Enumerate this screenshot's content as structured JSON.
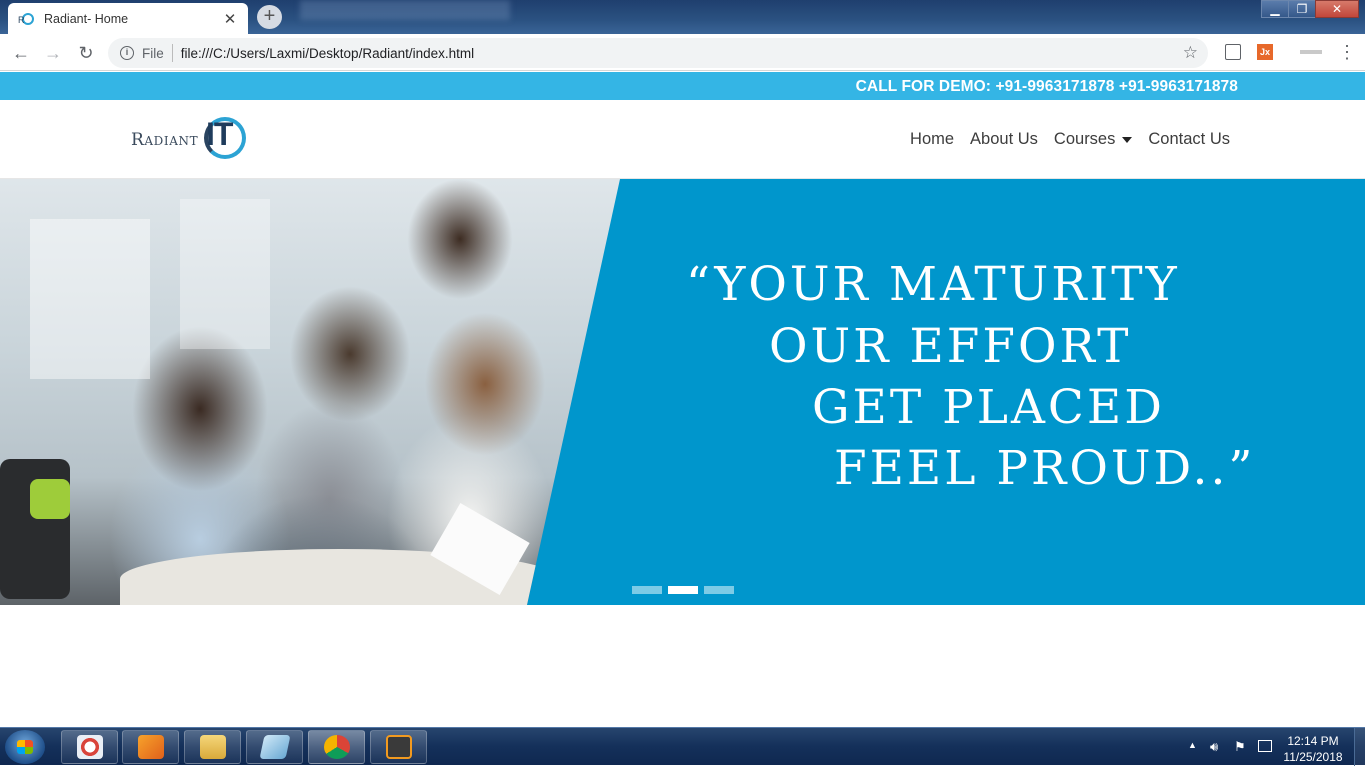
{
  "browser": {
    "tab_title": "Radiant- Home",
    "tab_close": "✕",
    "new_tab": "+",
    "scheme_label": "File",
    "url": "file:///C:/Users/Laxmi/Desktop/Radiant/index.html",
    "star": "☆",
    "back": "←",
    "forward": "→",
    "reload": "↻",
    "menu": "⋮",
    "window_controls": {
      "minimize": "▁",
      "restore": "❐",
      "close": "✕"
    },
    "ext_jx": "Jx"
  },
  "site": {
    "topbar_text": "CALL FOR DEMO: +91-9963171878 +91-9963171878",
    "logo": {
      "word": "Radiant",
      "mark": "IT"
    },
    "nav": {
      "home": "Home",
      "about": "About Us",
      "courses": "Courses",
      "contact": "Contact Us"
    },
    "hero": {
      "quote_lines": [
        "“YOUR MATURITY",
        "OUR EFFORT",
        "GET PLACED",
        "FEEL PROUD..”"
      ],
      "slides_total": 3,
      "active_slide": 2
    },
    "colors": {
      "topbar": "#34b5e5",
      "hero_bg": "#0096cc",
      "nav_text": "#3d3d3d"
    }
  },
  "taskbar": {
    "time": "12:14 PM",
    "date": "11/25/2018",
    "apps": [
      "snipping-tool",
      "media-player",
      "file-explorer",
      "notepad",
      "chrome",
      "sublime-text"
    ]
  }
}
